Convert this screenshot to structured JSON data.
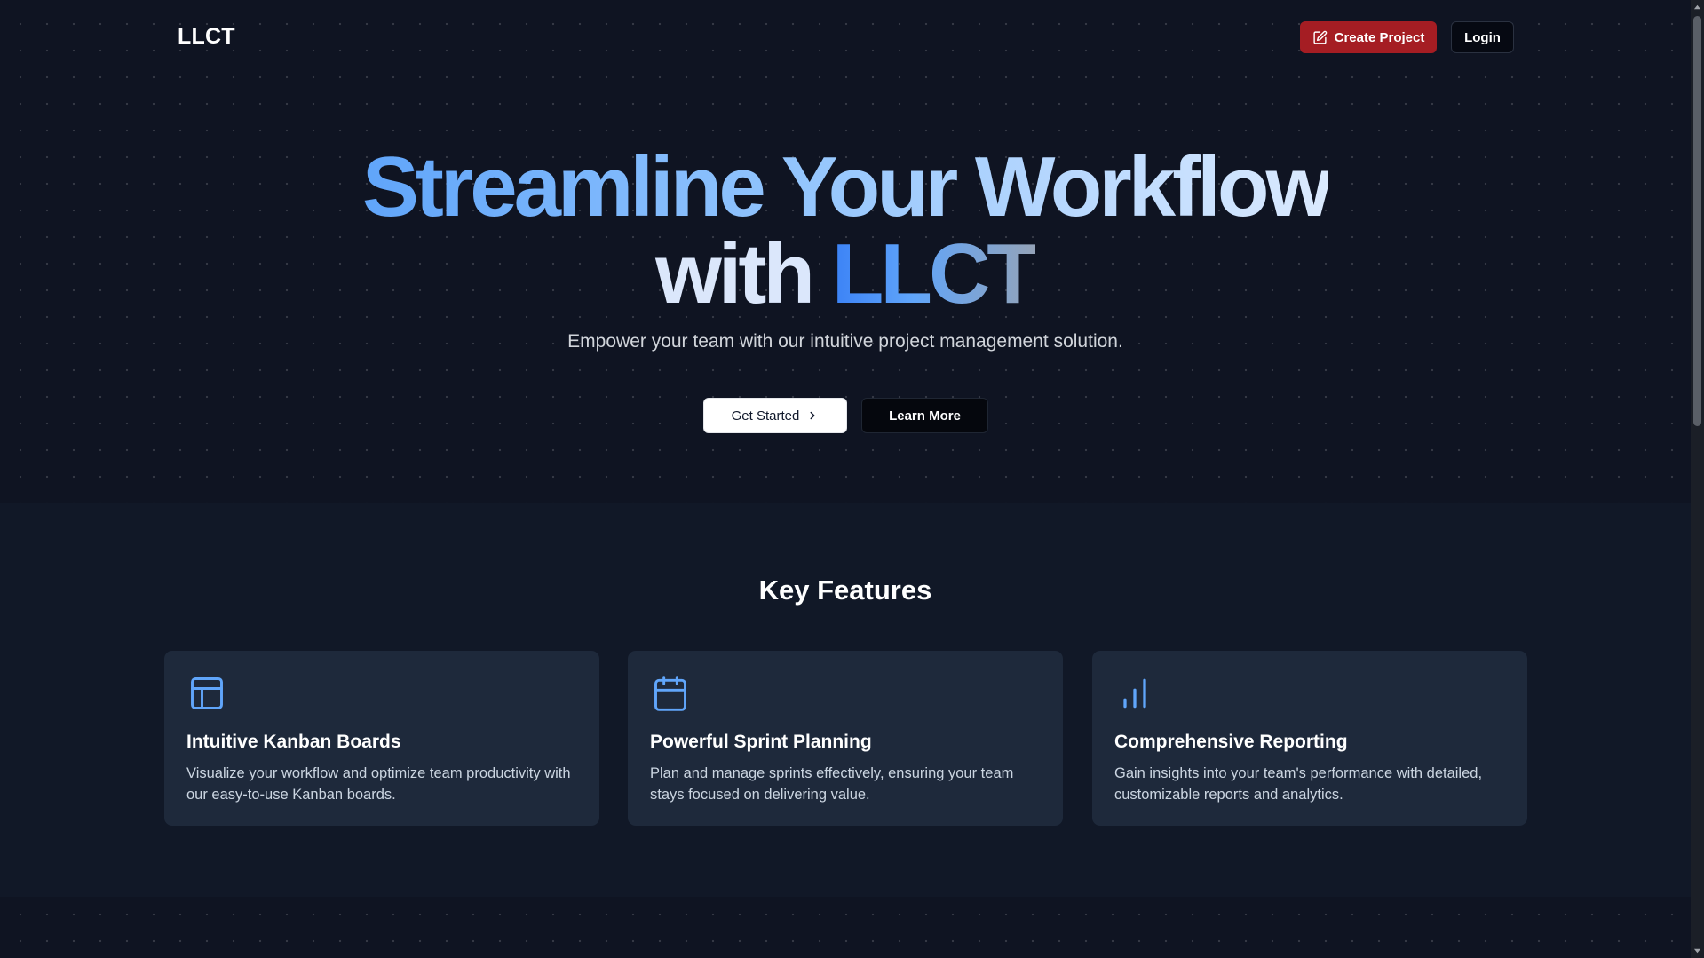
{
  "navbar": {
    "logo": "LLCT",
    "create_label": "Create Project",
    "login_label": "Login"
  },
  "hero": {
    "headline_line1": "Streamline Your Workflow",
    "headline_with": "with",
    "headline_brand": "LLCT",
    "subtitle": "Empower your team with our intuitive project management solution.",
    "get_started_label": "Get Started",
    "learn_more_label": "Learn More"
  },
  "features": {
    "title": "Key Features",
    "cards": [
      {
        "icon": "layout-icon",
        "title": "Intuitive Kanban Boards",
        "desc": "Visualize your workflow and optimize team productivity with our easy-to-use Kanban boards."
      },
      {
        "icon": "calendar-icon",
        "title": "Powerful Sprint Planning",
        "desc": "Plan and manage sprints effectively, ensuring your team stays focused on delivering value."
      },
      {
        "icon": "bar-chart-icon",
        "title": "Comprehensive Reporting",
        "desc": "Gain insights into your team's performance with detailed, customizable reports and analytics."
      }
    ]
  },
  "colors": {
    "accent": "#a51d23",
    "icon_blue": "#60a5fa",
    "card_bg": "#1e293b"
  }
}
